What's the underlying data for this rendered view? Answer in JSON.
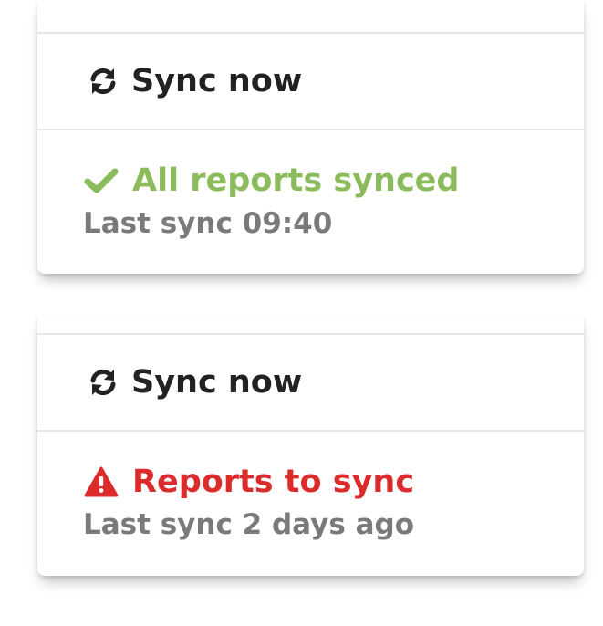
{
  "colors": {
    "success": "#8bbb5a",
    "danger": "#dc2b2b",
    "text": "#222222",
    "muted": "#7a7a7a"
  },
  "cards": [
    {
      "sync_button": {
        "label": "Sync now",
        "icon": "refresh-icon"
      },
      "status": {
        "icon": "check-icon",
        "text": "All reports synced",
        "state": "success"
      },
      "last_sync": "Last sync 09:40"
    },
    {
      "sync_button": {
        "label": "Sync now",
        "icon": "refresh-icon"
      },
      "status": {
        "icon": "warning-triangle-icon",
        "text": "Reports to sync",
        "state": "danger"
      },
      "last_sync": "Last sync 2 days ago"
    }
  ]
}
